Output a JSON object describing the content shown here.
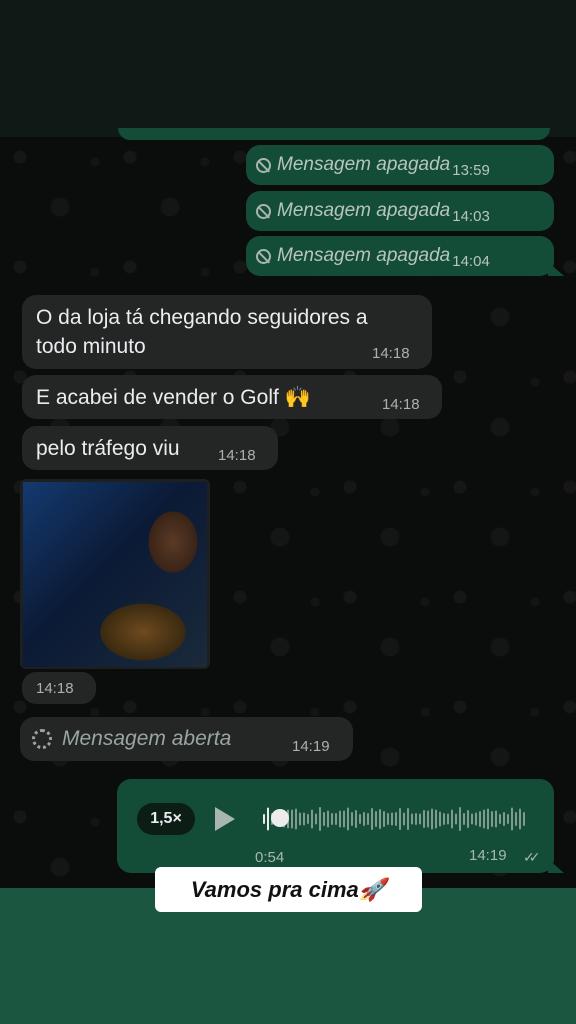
{
  "deleted_messages": [
    {
      "text": "Mensagem apagada",
      "time": "13:59"
    },
    {
      "text": "Mensagem apagada",
      "time": "14:03"
    },
    {
      "text": "Mensagem apagada",
      "time": "14:04"
    }
  ],
  "incoming": [
    {
      "text_line1": "O da loja tá chegando seguidores a",
      "text_line2": "todo minuto",
      "time": "14:18"
    },
    {
      "text": "E acabei de vender o Golf 🙌",
      "time": "14:18"
    },
    {
      "text": "pelo tráfego viu",
      "time": "14:18"
    }
  ],
  "photo_message": {
    "time": "14:18"
  },
  "view_once": {
    "text": "Mensagem aberta",
    "time": "14:19",
    "icon": "view-once-spinner-icon"
  },
  "audio_message": {
    "speed": "1,5×",
    "duration": "0:54",
    "time": "14:19",
    "status_icon": "double-check-icon",
    "progress": 0.03
  },
  "caption": {
    "text": "Vamos pra cima🚀"
  },
  "colors": {
    "outgoing": "#134d37",
    "incoming": "#242626",
    "chat_bg": "#0b0c0c",
    "bottom_band": "#1a5640"
  }
}
